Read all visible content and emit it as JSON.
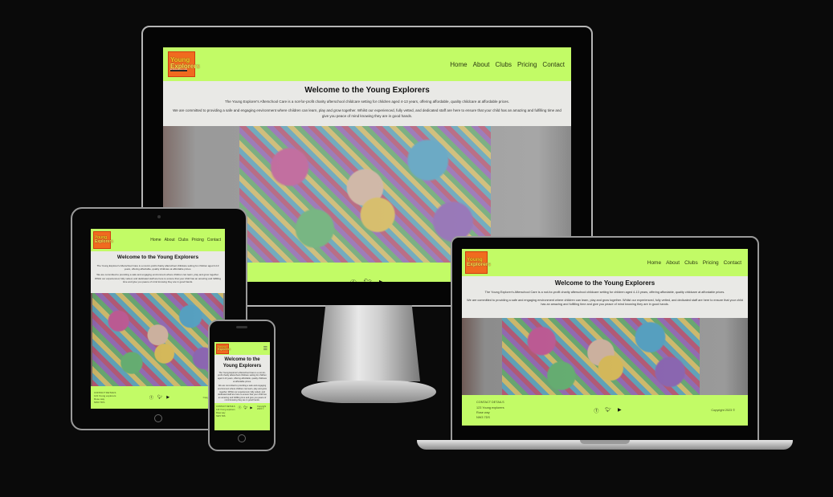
{
  "site": {
    "logo": {
      "line1": "Young",
      "line2": "Explorers",
      "sub": "AFTERSCHOOL CLUB"
    },
    "nav": [
      "Home",
      "About",
      "Clubs",
      "Pricing",
      "Contact"
    ],
    "title": "Welcome to the Young Explorers",
    "intro1": "The Young Explorer's Afterschool Care is a not-for-profit charity afterschool childcare setting for children aged 4-13 years, offering affordable, quality childcare at affordable prices.",
    "intro2": "We are committed to providing a safe and engaging environment where children can learn, play and grow together. Whilst our experienced, fully vetted, and dedicated staff are here to ensure that your child has an amazing and fulfilling time and give you peace of mind knowing they are in good hands.",
    "footer": {
      "contact_title": "CONTACT DETAILS",
      "address1": "123 Young explorers",
      "address2": "Rose way",
      "address3": "NW3 7DS",
      "copyright": "Copyright 2023 ©"
    },
    "social_icons": [
      "facebook-icon",
      "twitter-icon",
      "youtube-icon"
    ]
  },
  "colors": {
    "accent": "#c2fb66",
    "background": "#0a0a0a",
    "logo": "#f06b1f"
  }
}
